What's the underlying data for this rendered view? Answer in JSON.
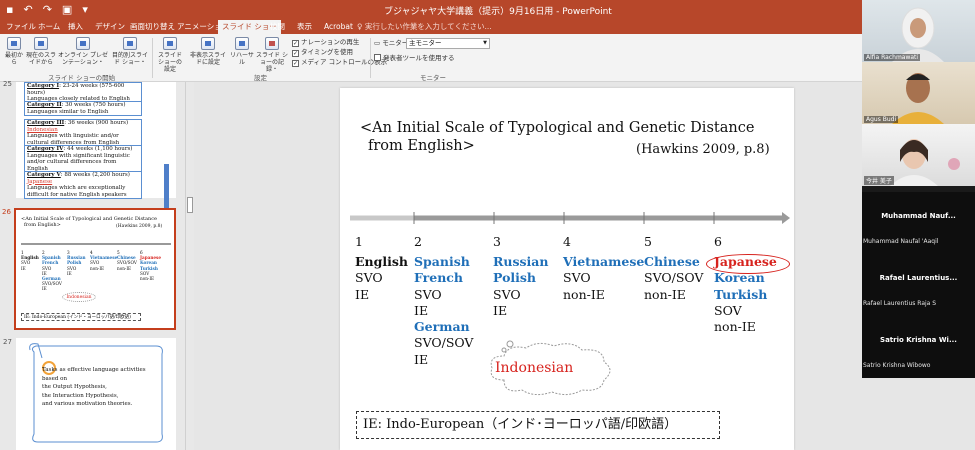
{
  "titlebar": {
    "doc_title": "ブジャジャヤ大学講義（提示）9月16日用 - PowerPoint",
    "qat": [
      "save-icon",
      "undo-icon",
      "redo-icon",
      "slideshow-icon",
      "customize-icon"
    ]
  },
  "tabs": [
    "ファイル",
    "ホーム",
    "挿入",
    "デザイン",
    "画面切り替え",
    "アニメーション",
    "スライド ショー",
    "校閲",
    "表示",
    "Acrobat"
  ],
  "active_tab_index": 6,
  "tell_me": "実行したい作業を入力してください...",
  "ribbon": {
    "start_buttons": [
      "最初から",
      "現在のスライドから",
      "オンライン プレゼンテーション・",
      "目的別スライド ショー・"
    ],
    "start_group": "スライド ショーの開始",
    "setup_buttons": [
      "スライド ショーの設定",
      "非表示スライドに設定",
      "リハーサル",
      "スライド ショーの記録・"
    ],
    "setup_checks": [
      "ナレーションの再生",
      "タイミングを使用",
      "メディア コントロールの表示"
    ],
    "setup_group": "設定",
    "monitor_label": "モニター:",
    "monitor_value": "主モニター",
    "presenter_view": "発表者ツールを使用する",
    "monitor_group": "モニター"
  },
  "thumbnails": {
    "slide25_num": "25",
    "categories": [
      {
        "head": "Category I",
        "tail": ": 23-24 weeks (575-600 hours)",
        "desc": "Languages closely related to English",
        "mark": ""
      },
      {
        "head": "Category II",
        "tail": ": 30 weeks (750 hours)",
        "desc": "Languages similar to English",
        "mark": ""
      },
      {
        "head": "Category III",
        "tail": ": 36 weeks (900 hours)",
        "desc": "Languages with linguistic and/or cultural differences from English",
        "mark": "Indonesian"
      },
      {
        "head": "Category IV",
        "tail": ": 44 weeks (1,100 hours)",
        "desc": "Languages with significant linguistic and/or cultural differences from English",
        "mark": ""
      },
      {
        "head": "Category V",
        "tail": ": 88 weeks (2,200 hours)",
        "desc": "Languages which are exceptionally difficult for native English speakers",
        "mark": "Japanese"
      }
    ],
    "slide26_num": "26",
    "slide26_mini_title": "<An Initial Scale of Typological and Genetic Distance",
    "slide26_mini_title2": "from English>",
    "slide26_mini_ref": "(Hawkins 2009, p.8)",
    "slide26_mini_ie": "IE: Indo-European (インド・ヨーロッパ語/印欧語)",
    "slide26_mini_indo": "Indonesian",
    "slide27_num": "27",
    "slide27_lines": [
      "Tasks",
      "as effective language activities",
      "based on",
      "the Output Hypothesis,",
      "the Interaction Hypothesis,",
      "and various motivation theories."
    ]
  },
  "slide": {
    "title_line1": "<An Initial Scale of Typological and Genetic Distance",
    "title_line2": "from English>",
    "ref": "(Hawkins 2009, p.8)",
    "columns": [
      {
        "num": "1",
        "rows": [
          {
            "t": "English",
            "c": "k"
          },
          {
            "t": "SVO",
            "c": "n"
          },
          {
            "t": "IE",
            "c": "n"
          }
        ]
      },
      {
        "num": "2",
        "rows": [
          {
            "t": "Spanish",
            "c": "b"
          },
          {
            "t": "French",
            "c": "b"
          },
          {
            "t": "SVO",
            "c": "n"
          },
          {
            "t": "IE",
            "c": "n"
          },
          {
            "t": "German",
            "c": "b"
          },
          {
            "t": "SVO/SOV",
            "c": "n"
          },
          {
            "t": "IE",
            "c": "n"
          }
        ]
      },
      {
        "num": "3",
        "rows": [
          {
            "t": "Russian",
            "c": "b"
          },
          {
            "t": "Polish",
            "c": "b"
          },
          {
            "t": "SVO",
            "c": "n"
          },
          {
            "t": "IE",
            "c": "n"
          }
        ]
      },
      {
        "num": "4",
        "rows": [
          {
            "t": "Vietnamese",
            "c": "b"
          },
          {
            "t": "SVO",
            "c": "n"
          },
          {
            "t": "non-IE",
            "c": "n"
          }
        ]
      },
      {
        "num": "5",
        "rows": [
          {
            "t": "Chinese",
            "c": "b"
          },
          {
            "t": "SVO/SOV",
            "c": "n"
          },
          {
            "t": "non-IE",
            "c": "n"
          }
        ]
      },
      {
        "num": "6",
        "rows": [
          {
            "t": "Japanese",
            "c": "r"
          },
          {
            "t": "Korean",
            "c": "b"
          },
          {
            "t": "Turkish",
            "c": "b"
          },
          {
            "t": "SOV",
            "c": "n"
          },
          {
            "t": "non-IE",
            "c": "n"
          }
        ]
      }
    ],
    "indonesian": "Indonesian",
    "ie_note": "IE: Indo-European（インド･ヨーロッパ語/印欧語）"
  },
  "participants": [
    {
      "name": "Alfia Rachmawati",
      "video": true
    },
    {
      "name": "Agus Budi",
      "video": true
    },
    {
      "name": "今井 美子",
      "video": true
    },
    {
      "name": "Muhammad Nauf...",
      "sub": "Muhammad Naufal 'Aaqil",
      "video": false
    },
    {
      "name": "Rafael Laurentius...",
      "sub": "Rafael Laurentius Raja S",
      "video": false
    },
    {
      "name": "Satrio Krishna Wi...",
      "sub": "Satrio Krishna Wibowo",
      "video": false
    }
  ],
  "colors": {
    "accent": "#b7472a",
    "blue": "#1f6fb8",
    "red": "#d7231e"
  }
}
